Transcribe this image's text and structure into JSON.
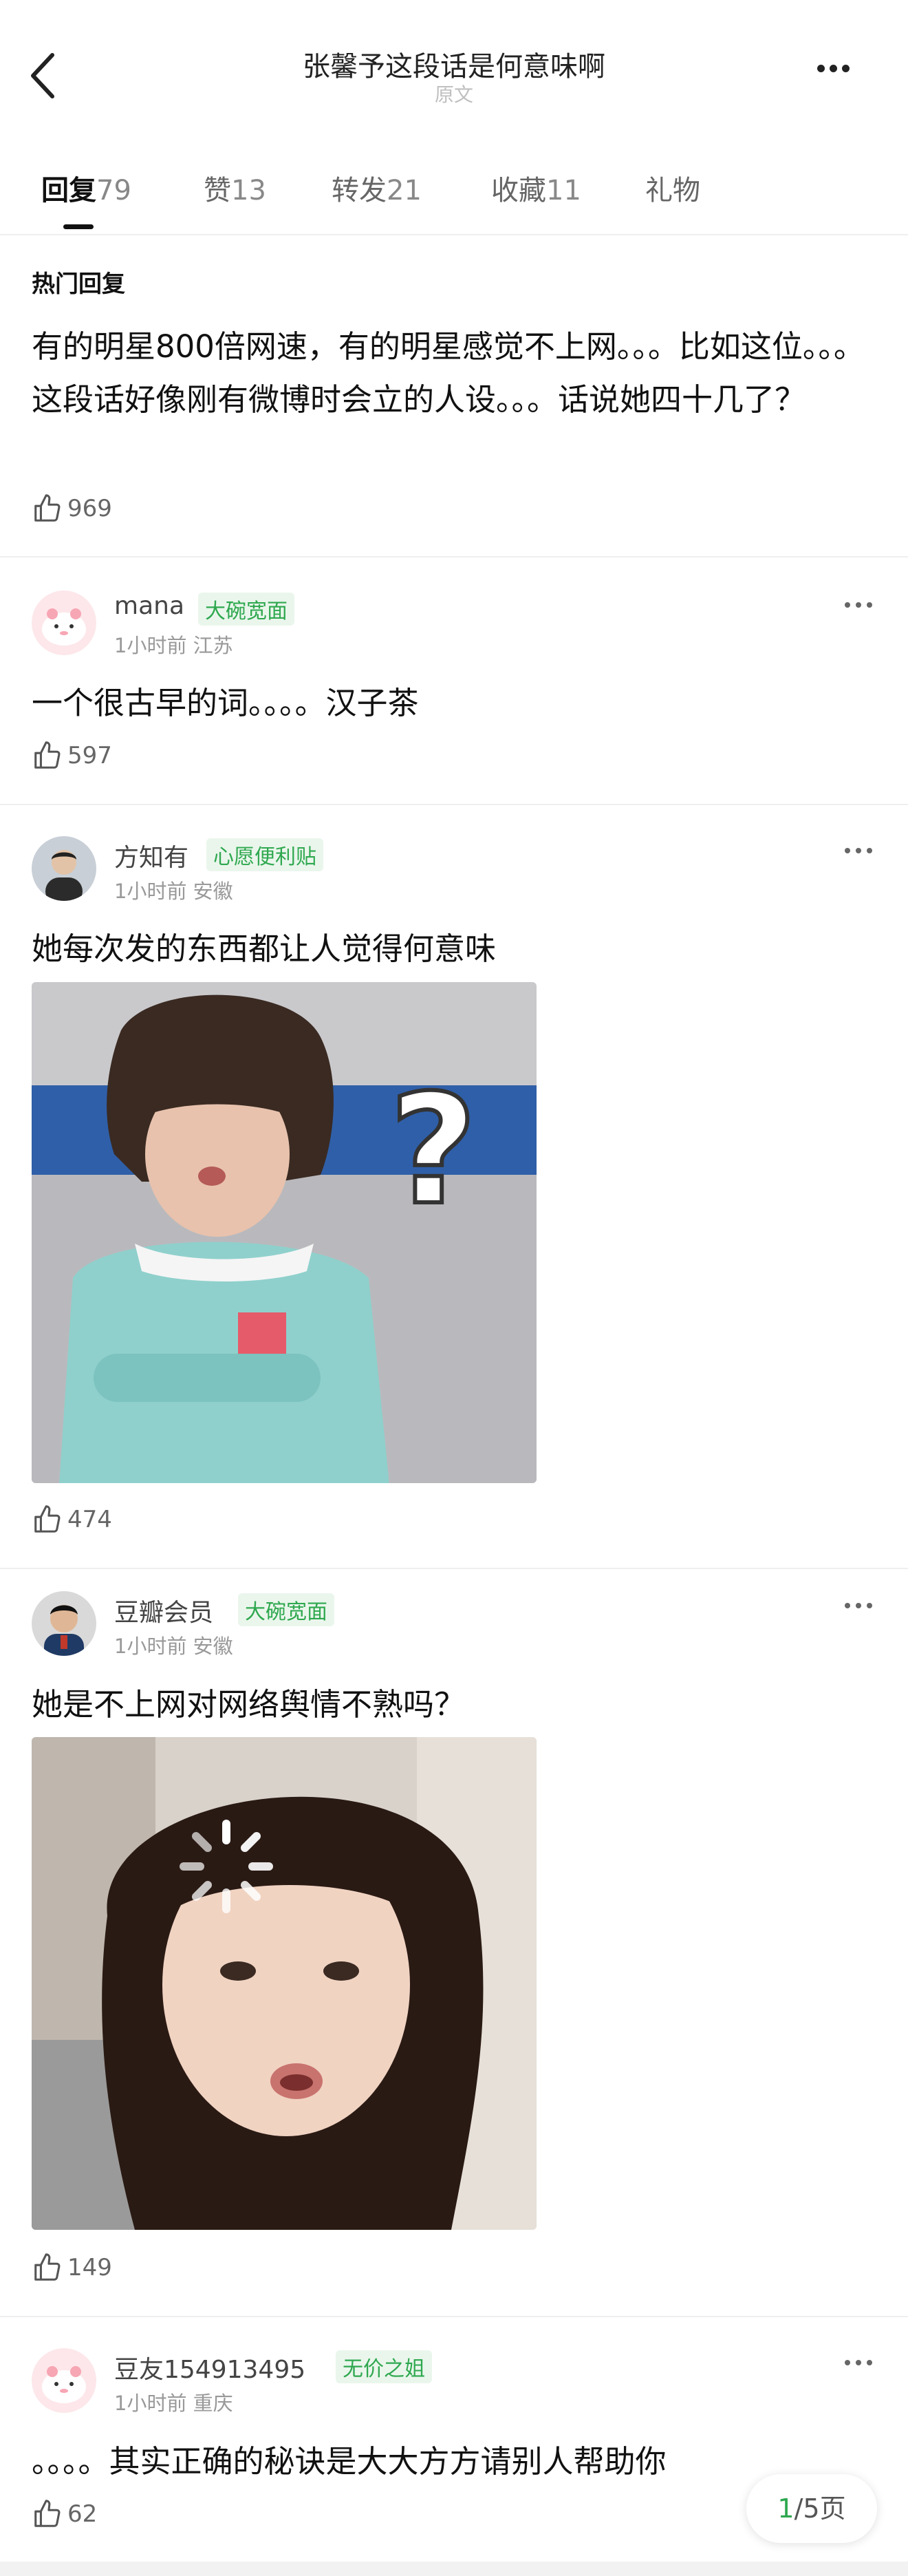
{
  "header": {
    "title": "张馨予这段话是何意味啊",
    "subtitle": "原文"
  },
  "tabs": [
    {
      "label": "回复",
      "count": "79"
    },
    {
      "label": "赞",
      "count": "13"
    },
    {
      "label": "转发",
      "count": "21"
    },
    {
      "label": "收藏",
      "count": "11"
    },
    {
      "label": "礼物",
      "count": ""
    }
  ],
  "hot": {
    "section_title": "热门回复",
    "text": "有的明星800倍网速，有的明星感觉不上网。。。比如这位。。。这段话好像刚有微博时会立的人设。。。话说她四十几了？",
    "likes": "969"
  },
  "comments": [
    {
      "name": "mana",
      "badge": "大碗宽面",
      "meta": "1小时前 江苏",
      "text": "一个很古早的词。。。。汉子茶",
      "likes": "597"
    },
    {
      "name": "方知有",
      "badge": "心愿便利贴",
      "meta": "1小时前 安徽",
      "text": "她每次发的东西都让人觉得何意味",
      "likes": "474"
    },
    {
      "name": "豆瓣会员",
      "badge": "大碗宽面",
      "meta": "1小时前 安徽",
      "text": "她是不上网对网络舆情不熟吗？",
      "likes": "149"
    },
    {
      "name": "豆友154913495",
      "badge": "无价之姐",
      "meta": "1小时前 重庆",
      "text": "。。。。其实正确的秘诀是大大方方请别人帮助你",
      "likes": "62"
    }
  ],
  "pager": {
    "current": "1",
    "total": "/5页"
  },
  "colors": {
    "accent_green": "#2fa84f",
    "badge_bg": "#eaf6ec",
    "divider": "#efefef"
  },
  "icons": [
    "back-arrow-icon",
    "more-icon",
    "thumb-up-icon",
    "question-mark-icon",
    "loading-spinner-icon"
  ]
}
